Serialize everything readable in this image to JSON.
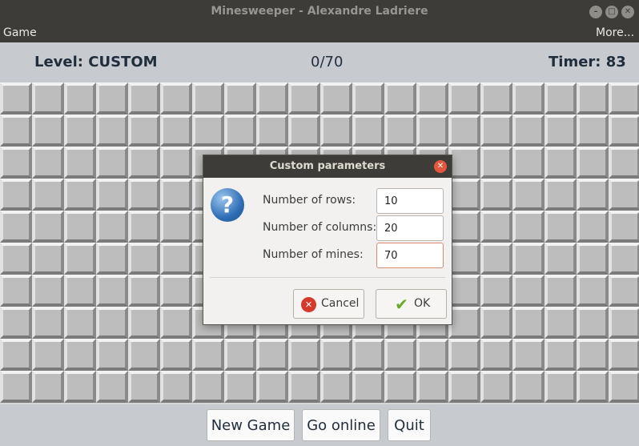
{
  "window": {
    "title": "Minesweeper - Alexandre Ladriere"
  },
  "menu": {
    "game": "Game",
    "more": "More..."
  },
  "status": {
    "level": "Level: CUSTOM",
    "count": "0/70",
    "timer": "Timer: 83"
  },
  "board": {
    "rows": 10,
    "cols": 20
  },
  "buttons": {
    "new_game": "New Game",
    "go_online": "Go online",
    "quit": "Quit"
  },
  "dialog": {
    "title": "Custom parameters",
    "rows_label": "Number of rows:",
    "rows_value": "10",
    "cols_label": "Number of columns:",
    "cols_value": "20",
    "mines_label": "Number of mines:",
    "mines_value": "70",
    "cancel": "Cancel",
    "ok": "OK"
  }
}
